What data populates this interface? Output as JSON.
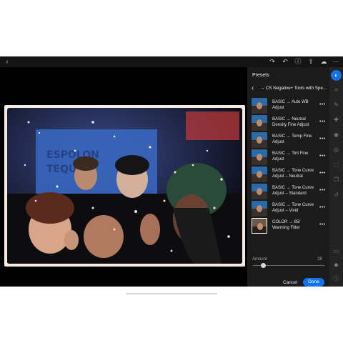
{
  "topbar": {
    "back_icon": "chevron-left-icon",
    "right_icons": [
      "redo-icon",
      "undo-icon",
      "help-icon",
      "share-icon",
      "cloud-sync-icon",
      "more-icon"
    ]
  },
  "presets_panel": {
    "title": "Presets",
    "group_name": "→ CS Negative+ Tools with Spe...",
    "items": [
      {
        "label": "BASIC → Auto WB Adjust",
        "selected": false
      },
      {
        "label": "BASIC → Neutral Density Fine Adjust",
        "selected": false
      },
      {
        "label": "BASIC → Temp Fine Adjust",
        "selected": false
      },
      {
        "label": "BASIC → Tint Fine Adjust",
        "selected": false
      },
      {
        "label": "BASIC → Tone Curve Adjust – Neutral",
        "selected": false
      },
      {
        "label": "BASIC → Tone Curve Adjust – Standard",
        "selected": false
      },
      {
        "label": "BASIC → Tone Curve Adjust – Vivid",
        "selected": false
      },
      {
        "label": "COLOR → 85/ Warming Filter",
        "selected": true
      }
    ],
    "more_glyph": "•••",
    "amount": {
      "label": "Amount",
      "value": "28",
      "level": 0.28
    },
    "cancel_label": "Cancel",
    "done_label": "Done"
  },
  "rail": {
    "icons": [
      "presets-icon",
      "crop-icon",
      "edit-icon",
      "heal-icon",
      "masking-icon",
      "optics-icon",
      "geometry-icon",
      "versions-icon",
      "history-icon",
      "comment-icon",
      "tag-icon",
      "info-icon"
    ]
  },
  "colors": {
    "accent": "#1473e6",
    "panel_bg": "#1b1b1b",
    "rail_bg": "#232323",
    "photo_border": "#f4ece1"
  }
}
